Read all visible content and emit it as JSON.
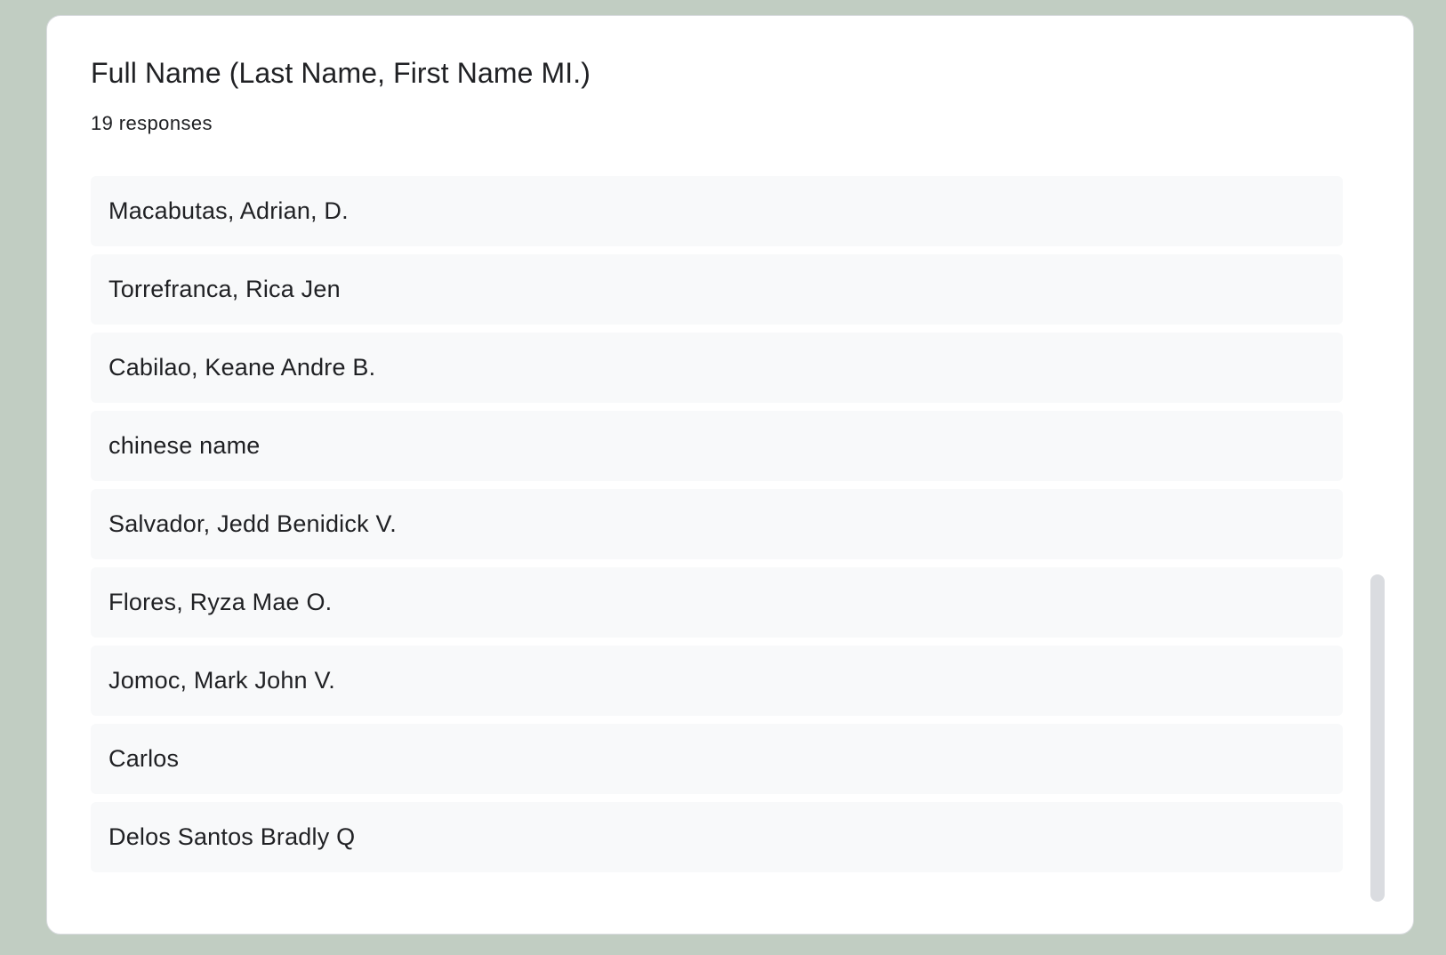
{
  "question": {
    "title": "Full Name (Last Name, First Name MI.)",
    "response_count": "19 responses"
  },
  "responses": [
    "",
    "Macabutas, Adrian, D.",
    "Torrefranca, Rica Jen",
    "Cabilao, Keane Andre B.",
    "chinese name",
    "Salvador, Jedd Benidick V.",
    "Flores, Ryza Mae O.",
    "Jomoc, Mark John V.",
    "Carlos",
    "Delos Santos Bradly Q"
  ],
  "scrollbar": {
    "scroll_fraction": 1.0,
    "visible_fraction": 0.45
  },
  "colors": {
    "page_background": "#c1cdc2",
    "card_background": "#ffffff",
    "item_background": "#f8f9fa",
    "text": "#202124",
    "scrollbar_thumb": "#dadce0"
  }
}
